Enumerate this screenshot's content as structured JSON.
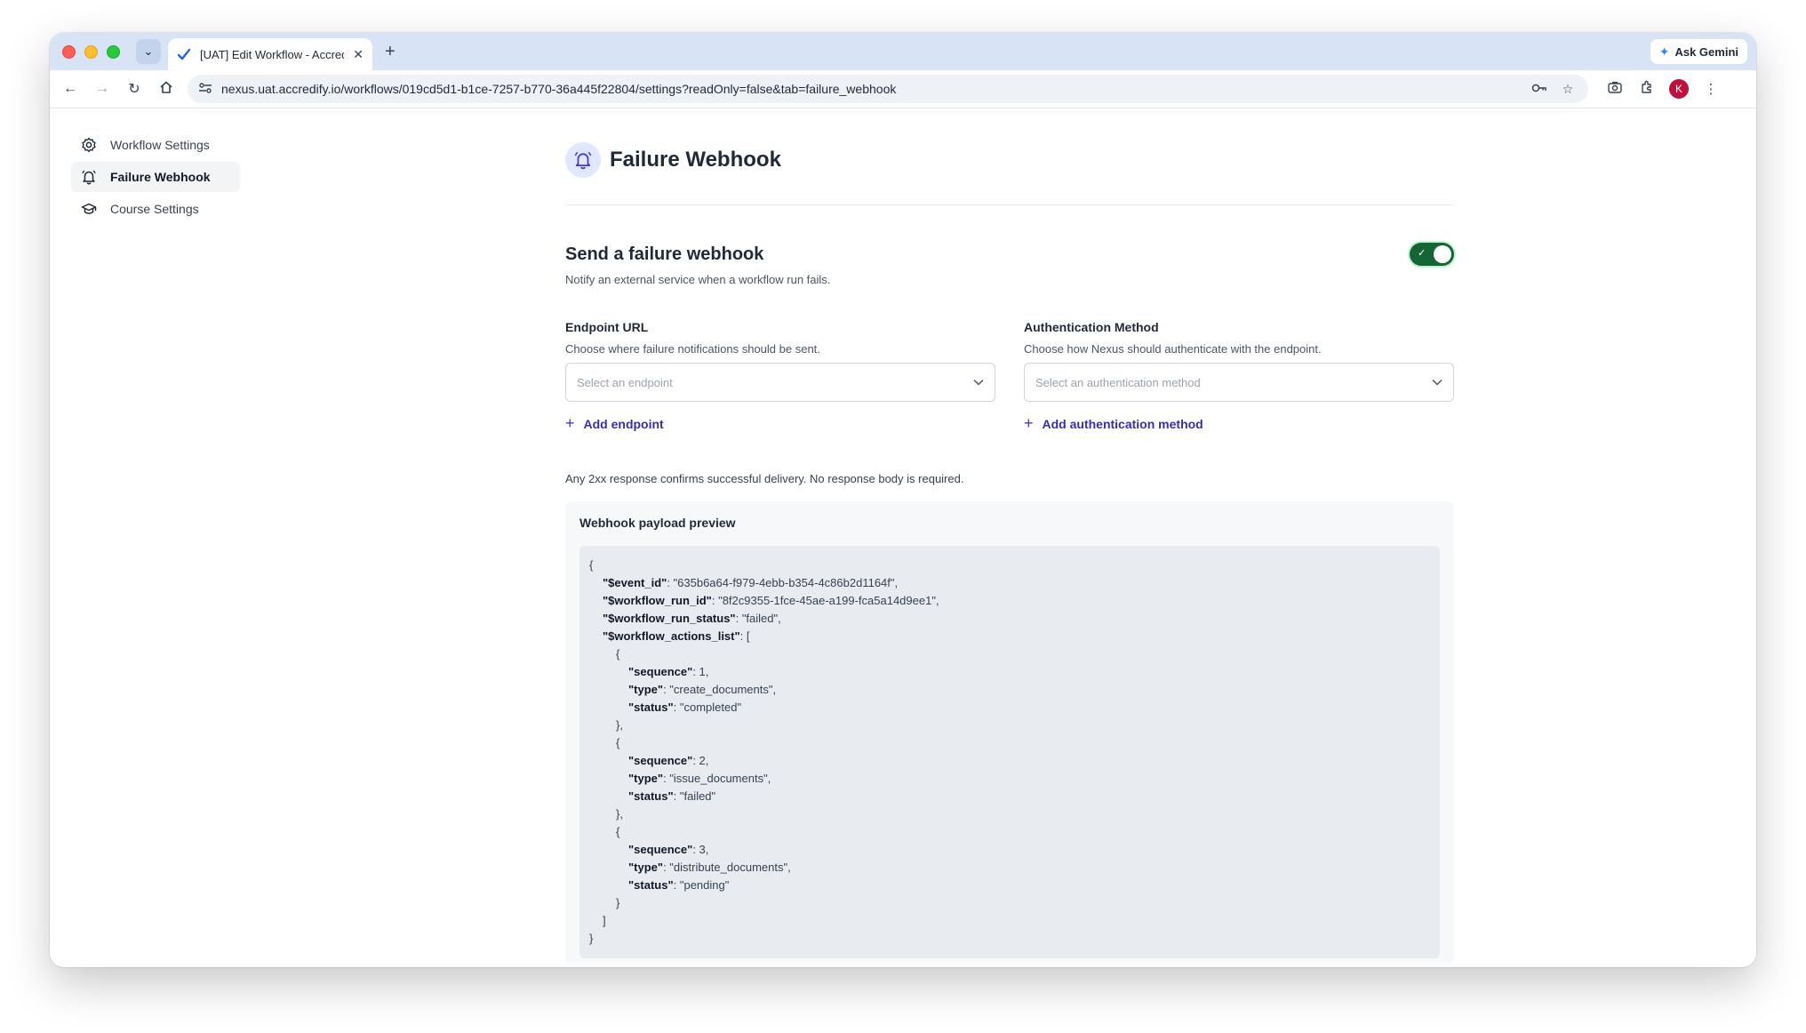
{
  "browser": {
    "tab_title": "[UAT] Edit Workflow - Accredify",
    "new_tab_symbol": "+",
    "gemini_label": "Ask Gemini",
    "url": "nexus.uat.accredify.io/workflows/019cd5d1-b1ce-7257-b770-36a445f22804/settings?readOnly=false&tab=failure_webhook",
    "profile_initial": "K"
  },
  "sidebar": {
    "items": [
      {
        "label": "Workflow Settings",
        "icon": "gear-icon"
      },
      {
        "label": "Failure Webhook",
        "icon": "bell-icon"
      },
      {
        "label": "Course Settings",
        "icon": "graduation-cap-icon"
      }
    ]
  },
  "main": {
    "title": "Failure Webhook",
    "section_title": "Send a failure webhook",
    "section_desc": "Notify an external service when a workflow run fails.",
    "toggle_on": true,
    "endpoint": {
      "label": "Endpoint URL",
      "help": "Choose where failure notifications should be sent.",
      "placeholder": "Select an endpoint",
      "add_label": "Add endpoint"
    },
    "auth": {
      "label": "Authentication Method",
      "help": "Choose how Nexus should authenticate with the endpoint.",
      "placeholder": "Select an authentication method",
      "add_label": "Add authentication method"
    },
    "note": "Any 2xx response confirms successful delivery. No response body is required.",
    "preview_title": "Webhook payload preview",
    "payload_lines": [
      {
        "indent": 0,
        "key": "",
        "value": "{"
      },
      {
        "indent": 1,
        "key": "\"$event_id\"",
        "value": ": \"635b6a64-f979-4ebb-b354-4c86b2d1164f\","
      },
      {
        "indent": 1,
        "key": "\"$workflow_run_id\"",
        "value": ": \"8f2c9355-1fce-45ae-a199-fca5a14d9ee1\","
      },
      {
        "indent": 1,
        "key": "\"$workflow_run_status\"",
        "value": ": \"failed\","
      },
      {
        "indent": 1,
        "key": "\"$workflow_actions_list\"",
        "value": ": ["
      },
      {
        "indent": 2,
        "key": "",
        "value": "{"
      },
      {
        "indent": 3,
        "key": "\"sequence\"",
        "value": ": 1,"
      },
      {
        "indent": 3,
        "key": "\"type\"",
        "value": ": \"create_documents\","
      },
      {
        "indent": 3,
        "key": "\"status\"",
        "value": ": \"completed\""
      },
      {
        "indent": 2,
        "key": "",
        "value": "},"
      },
      {
        "indent": 2,
        "key": "",
        "value": "{"
      },
      {
        "indent": 3,
        "key": "\"sequence\"",
        "value": ": 2,"
      },
      {
        "indent": 3,
        "key": "\"type\"",
        "value": ": \"issue_documents\","
      },
      {
        "indent": 3,
        "key": "\"status\"",
        "value": ": \"failed\""
      },
      {
        "indent": 2,
        "key": "",
        "value": "},"
      },
      {
        "indent": 2,
        "key": "",
        "value": "{"
      },
      {
        "indent": 3,
        "key": "\"sequence\"",
        "value": ": 3,"
      },
      {
        "indent": 3,
        "key": "\"type\"",
        "value": ": \"distribute_documents\","
      },
      {
        "indent": 3,
        "key": "\"status\"",
        "value": ": \"pending\""
      },
      {
        "indent": 2,
        "key": "",
        "value": "}"
      },
      {
        "indent": 1,
        "key": "",
        "value": "]"
      },
      {
        "indent": 0,
        "key": "",
        "value": "}"
      }
    ]
  }
}
